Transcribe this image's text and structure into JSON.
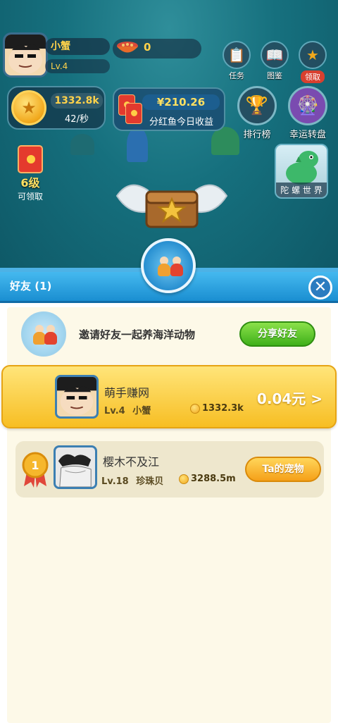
{
  "profile": {
    "name": "小蟹",
    "level": "Lv.4"
  },
  "fish_food": {
    "value": "0"
  },
  "top_icons": [
    {
      "label": "任务",
      "icon": "clipboard-icon"
    },
    {
      "label": "图鉴",
      "icon": "book-icon"
    },
    {
      "label": "领取",
      "icon": "star-coin-icon"
    }
  ],
  "coins": {
    "amount": "1332.8k",
    "rate": "42/秒"
  },
  "red_packet": {
    "amount": "¥210.26",
    "label": "分红鱼今日收益"
  },
  "side_icons": [
    {
      "label": "排行榜",
      "icon": "trophy-box-icon"
    },
    {
      "label": "幸运转盘",
      "icon": "wheel-icon"
    }
  ],
  "red_level": {
    "level": "6级",
    "label": "可领取"
  },
  "dino_world": {
    "label": "陀 螺 世 界"
  },
  "friends_panel": {
    "title": "好友 (1)",
    "invite_text": "邀请好友一起养海洋动物",
    "share_button": "分享好友",
    "friends": [
      {
        "name": "萌手赚网",
        "level": "Lv.4",
        "pet": "小蟹",
        "coins": "1332.3k",
        "earning": "0.04元 >"
      },
      {
        "rank": "1",
        "name": "樱木不及江",
        "level": "Lv.18",
        "pet": "珍珠贝",
        "coins": "3288.5m",
        "button": "Ta的宠物"
      }
    ]
  },
  "colors": {
    "panel_blue": "#1a8ed1",
    "gold": "#ffd24a",
    "green_button": "#3fb01a"
  }
}
